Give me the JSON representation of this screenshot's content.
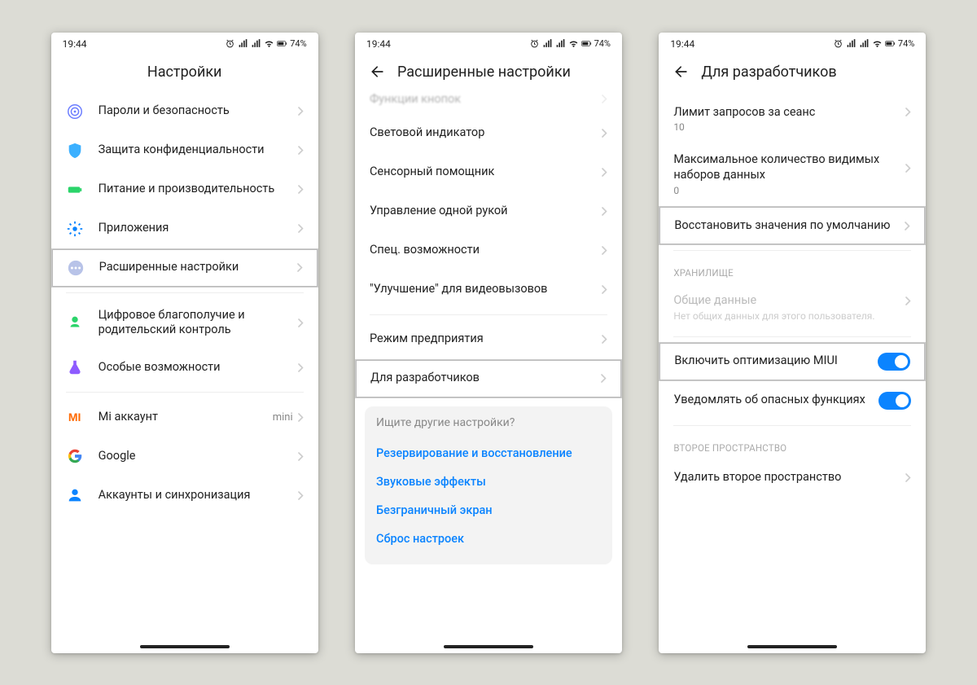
{
  "status": {
    "time": "19:44",
    "battery": "74%"
  },
  "screen1": {
    "title": "Настройки",
    "items": {
      "passwords": "Пароли и безопасность",
      "privacy": "Защита конфиденциальности",
      "power": "Питание и производительность",
      "apps": "Приложения",
      "advanced": "Расширенные настройки",
      "wellbeing": "Цифровое благополучие и родительский контроль",
      "special": "Особые возможности",
      "mi_account": "Mi аккаунт",
      "mi_account_value": "mini",
      "google": "Google",
      "accounts": "Аккаунты и синхронизация"
    }
  },
  "screen2": {
    "title": "Расширенные настройки",
    "cutoff": "Функции кнопок",
    "items": {
      "led": "Световой индикатор",
      "sensor": "Сенсорный помощник",
      "onehand": "Управление одной рукой",
      "accessibility": "Спец. возможности",
      "videocall": "\"Улучшение\" для видеовызовов",
      "enterprise": "Режим предприятия",
      "developer": "Для разработчиков"
    },
    "search": {
      "title": "Ищите другие настройки?",
      "links": {
        "backup": "Резервирование и восстановление",
        "sound": "Звуковые эффекты",
        "fullscreen": "Безграничный экран",
        "reset": "Сброс настроек"
      }
    }
  },
  "screen3": {
    "title": "Для разработчиков",
    "items": {
      "limit": "Лимит запросов за сеанс",
      "limit_val": "10",
      "maxsets": "Максимальное количество видимых наборов данных",
      "maxsets_val": "0",
      "restore": "Восстановить значения по умолчанию",
      "storage_section": "ХРАНИЛИЩЕ",
      "shared": "Общие данные",
      "shared_sub": "Нет общих данных для этого пользователя.",
      "miui_opt": "Включить оптимизацию MIUI",
      "danger": "Уведомлять об опасных функциях",
      "second_section": "ВТОРОЕ ПРОСТРАНСТВО",
      "delete_second": "Удалить второе пространство"
    }
  }
}
